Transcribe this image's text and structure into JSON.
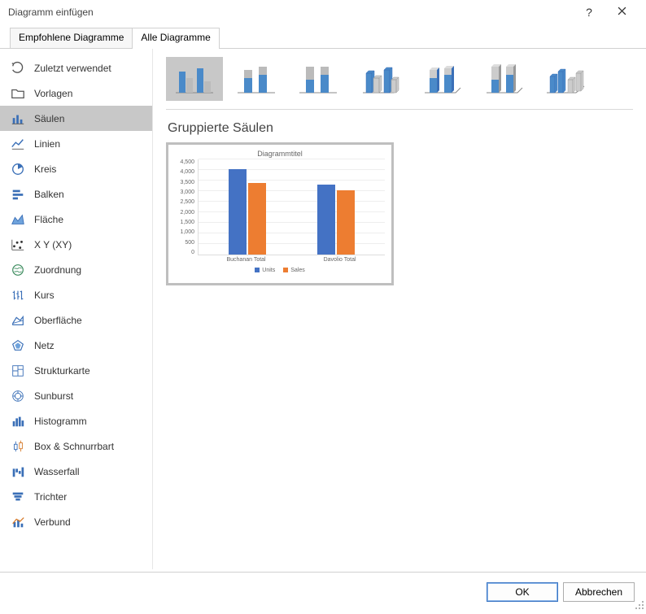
{
  "title": "Diagramm einfügen",
  "tabs": {
    "recommended": "Empfohlene Diagramme",
    "all": "Alle Diagramme"
  },
  "sidebar": {
    "items": [
      {
        "label": "Zuletzt verwendet"
      },
      {
        "label": "Vorlagen"
      },
      {
        "label": "Säulen"
      },
      {
        "label": "Linien"
      },
      {
        "label": "Kreis"
      },
      {
        "label": "Balken"
      },
      {
        "label": "Fläche"
      },
      {
        "label": "X Y (XY)"
      },
      {
        "label": "Zuordnung"
      },
      {
        "label": "Kurs"
      },
      {
        "label": "Oberfläche"
      },
      {
        "label": "Netz"
      },
      {
        "label": "Strukturkarte"
      },
      {
        "label": "Sunburst"
      },
      {
        "label": "Histogramm"
      },
      {
        "label": "Box & Schnurrbart"
      },
      {
        "label": "Wasserfall"
      },
      {
        "label": "Trichter"
      },
      {
        "label": "Verbund"
      }
    ]
  },
  "subtype_title": "Gruppierte Säulen",
  "chart_preview": {
    "title": "Diagrammtitel",
    "legend": {
      "s1": "Units",
      "s2": "Sales"
    },
    "xlabels": {
      "c1": "Buchanan Total",
      "c2": "Davolio Total"
    },
    "yaxis": [
      "4,500",
      "4,000",
      "3,500",
      "3,000",
      "2,500",
      "2,000",
      "1,500",
      "1,000",
      "500",
      "0"
    ]
  },
  "chart_data": {
    "type": "bar",
    "title": "Diagrammtitel",
    "categories": [
      "Buchanan Total",
      "Davolio Total"
    ],
    "series": [
      {
        "name": "Units",
        "values": [
          4050,
          3300
        ],
        "color": "#4472c4"
      },
      {
        "name": "Sales",
        "values": [
          3400,
          3050
        ],
        "color": "#ed7d31"
      }
    ],
    "ylim": [
      0,
      4500
    ],
    "ylabel": "",
    "xlabel": ""
  },
  "buttons": {
    "ok": "OK",
    "cancel": "Abbrechen"
  }
}
